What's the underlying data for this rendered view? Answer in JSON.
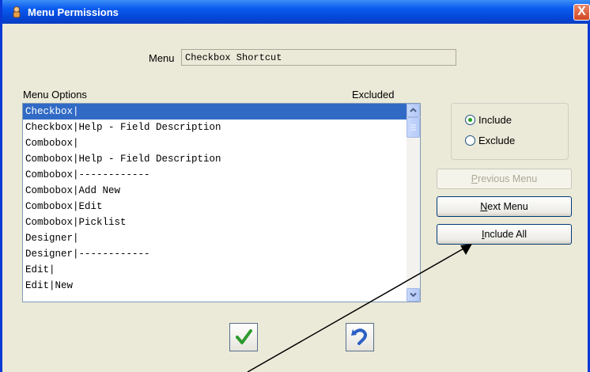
{
  "window": {
    "title": "Menu Permissions",
    "close_label": "X"
  },
  "menu": {
    "label": "Menu",
    "value": "Checkbox Shortcut"
  },
  "list": {
    "header_options": "Menu Options",
    "header_excluded": "Excluded",
    "items": [
      "Checkbox|",
      "Checkbox|Help - Field Description",
      "Combobox|",
      "Combobox|Help - Field Description",
      "Combobox|------------",
      "Combobox|Add New",
      "Combobox|Edit",
      "Combobox|Picklist",
      "Designer|",
      "Designer|------------",
      "Edit|",
      "Edit|New"
    ],
    "selected_index": 0
  },
  "options": {
    "include_label": "Include",
    "exclude_label": "Exclude",
    "selected": "include"
  },
  "buttons": {
    "previous_menu_hotkey": "P",
    "previous_menu_rest": "revious Menu",
    "next_menu_hotkey": "N",
    "next_menu_rest": "ext Menu",
    "include_all_hotkey": "I",
    "include_all_rest": "nclude All"
  },
  "icons": {
    "ok": "checkmark-icon",
    "undo": "undo-icon"
  },
  "colors": {
    "titlebar": "#0346d6",
    "selection": "#316ac5",
    "ok_check": "#2e9a2e",
    "undo": "#2a5fc4"
  }
}
